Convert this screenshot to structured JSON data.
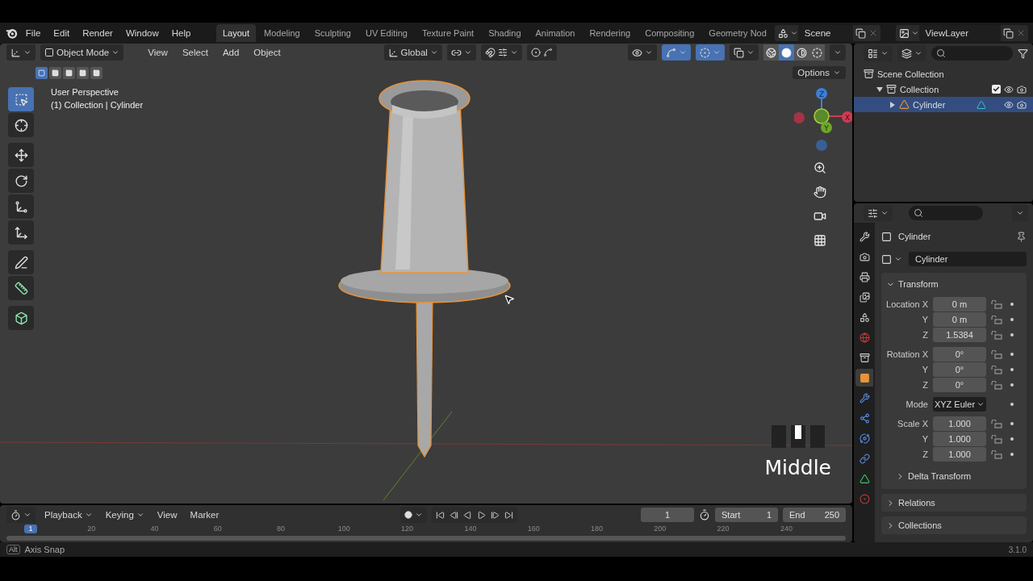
{
  "menu": [
    "File",
    "Edit",
    "Render",
    "Window",
    "Help"
  ],
  "workspaces": [
    {
      "label": "Layout",
      "selected": true
    },
    {
      "label": "Modeling",
      "selected": false
    },
    {
      "label": "Sculpting",
      "selected": false
    },
    {
      "label": "UV Editing",
      "selected": false
    },
    {
      "label": "Texture Paint",
      "selected": false
    },
    {
      "label": "Shading",
      "selected": false
    },
    {
      "label": "Animation",
      "selected": false
    },
    {
      "label": "Rendering",
      "selected": false
    },
    {
      "label": "Compositing",
      "selected": false
    },
    {
      "label": "Geometry Nod",
      "selected": false
    }
  ],
  "scene": "Scene",
  "view_layer": "ViewLayer",
  "viewport": {
    "mode": "Object Mode",
    "menus": [
      "View",
      "Select",
      "Add",
      "Object"
    ],
    "orientation": "Global",
    "select_modes": [
      {
        "selected": true
      },
      {
        "selected": false
      },
      {
        "selected": false
      },
      {
        "selected": false
      },
      {
        "selected": false
      }
    ],
    "toggles": [
      {
        "kind": "visibility",
        "on": false
      },
      {
        "kind": "gizmo",
        "on": true
      },
      {
        "kind": "overlay",
        "on": true
      },
      {
        "kind": "xray",
        "on": false
      }
    ],
    "shading": [
      {
        "kind": "wireframe",
        "selected": false
      },
      {
        "kind": "solid",
        "selected": true
      },
      {
        "kind": "material",
        "selected": false
      },
      {
        "kind": "rendered",
        "selected": false
      }
    ],
    "options": "Options",
    "title": "User Perspective",
    "subtitle": "(1) Collection | Cylinder",
    "tools": [
      {
        "kind": "select",
        "selected": true
      },
      {
        "kind": "cursor",
        "selected": false
      },
      {
        "kind": "move",
        "selected": false
      },
      {
        "kind": "rotate",
        "selected": false
      },
      {
        "kind": "scale",
        "selected": false
      },
      {
        "kind": "transform",
        "selected": false
      },
      {
        "kind": "annotate",
        "selected": false
      },
      {
        "kind": "measure",
        "selected": false
      },
      {
        "kind": "add_cube",
        "selected": false
      }
    ],
    "gizmo": {
      "z": "Z",
      "x": "X",
      "y": "Y"
    },
    "key_overlay": {
      "label": "Middle",
      "buttons": [
        {
          "pressed": false
        },
        {
          "pressed": true
        },
        {
          "pressed": false
        }
      ]
    }
  },
  "outliner": {
    "items": [
      {
        "label": "Scene Collection",
        "children": [
          {
            "label": "Collection",
            "expanded": true,
            "checked": true,
            "selected": false,
            "children": [
              {
                "label": "Cylinder",
                "expanded": false,
                "selected": true
              }
            ]
          }
        ]
      }
    ]
  },
  "properties": {
    "header": "Cylinder",
    "name": "Cylinder",
    "tabs": [
      {
        "kind": "tool",
        "selected": false
      },
      {
        "kind": "render",
        "selected": false
      },
      {
        "kind": "output",
        "selected": false
      },
      {
        "kind": "view_layer",
        "selected": false
      },
      {
        "kind": "scene",
        "selected": false
      },
      {
        "kind": "world",
        "selected": false
      },
      {
        "kind": "collection",
        "selected": false
      },
      {
        "kind": "object",
        "selected": true
      },
      {
        "kind": "modifiers",
        "selected": false
      },
      {
        "kind": "particles",
        "selected": false
      },
      {
        "kind": "physics",
        "selected": false
      },
      {
        "kind": "constraints",
        "selected": false
      },
      {
        "kind": "data",
        "selected": false
      },
      {
        "kind": "material",
        "selected": false
      }
    ],
    "transform": {
      "title": "Transform",
      "expanded": true,
      "groups": [
        [
          {
            "label": "Location X",
            "value": "0 m",
            "kind": "number"
          },
          {
            "label": "Y",
            "value": "0 m",
            "kind": "number"
          },
          {
            "label": "Z",
            "value": "1.5384",
            "kind": "number"
          }
        ],
        [
          {
            "label": "Rotation X",
            "value": "0°",
            "kind": "number"
          },
          {
            "label": "Y",
            "value": "0°",
            "kind": "number"
          },
          {
            "label": "Z",
            "value": "0°",
            "kind": "number"
          }
        ],
        [
          {
            "label": "Mode",
            "value": "XYZ Euler",
            "kind": "dropdown"
          }
        ],
        [
          {
            "label": "Scale X",
            "value": "1.000",
            "kind": "number"
          },
          {
            "label": "Y",
            "value": "1.000",
            "kind": "number"
          },
          {
            "label": "Z",
            "value": "1.000",
            "kind": "number"
          }
        ]
      ],
      "subpanels": [
        {
          "title": "Delta Transform",
          "expanded": false
        }
      ]
    },
    "panels": [
      {
        "title": "Relations",
        "expanded": false
      },
      {
        "title": "Collections",
        "expanded": false
      }
    ]
  },
  "timeline": {
    "menus": [
      "Playback",
      "Keying",
      "View",
      "Marker"
    ],
    "current_frame": "1",
    "start_label": "Start",
    "start": "1",
    "end_label": "End",
    "end": "250",
    "playhead": "1",
    "ticks": [
      "20",
      "40",
      "60",
      "80",
      "100",
      "120",
      "140",
      "160",
      "180",
      "200",
      "220",
      "240"
    ]
  },
  "status_bar": {
    "key": "Alt",
    "hint": "Axis Snap",
    "version": "3.1.0"
  }
}
